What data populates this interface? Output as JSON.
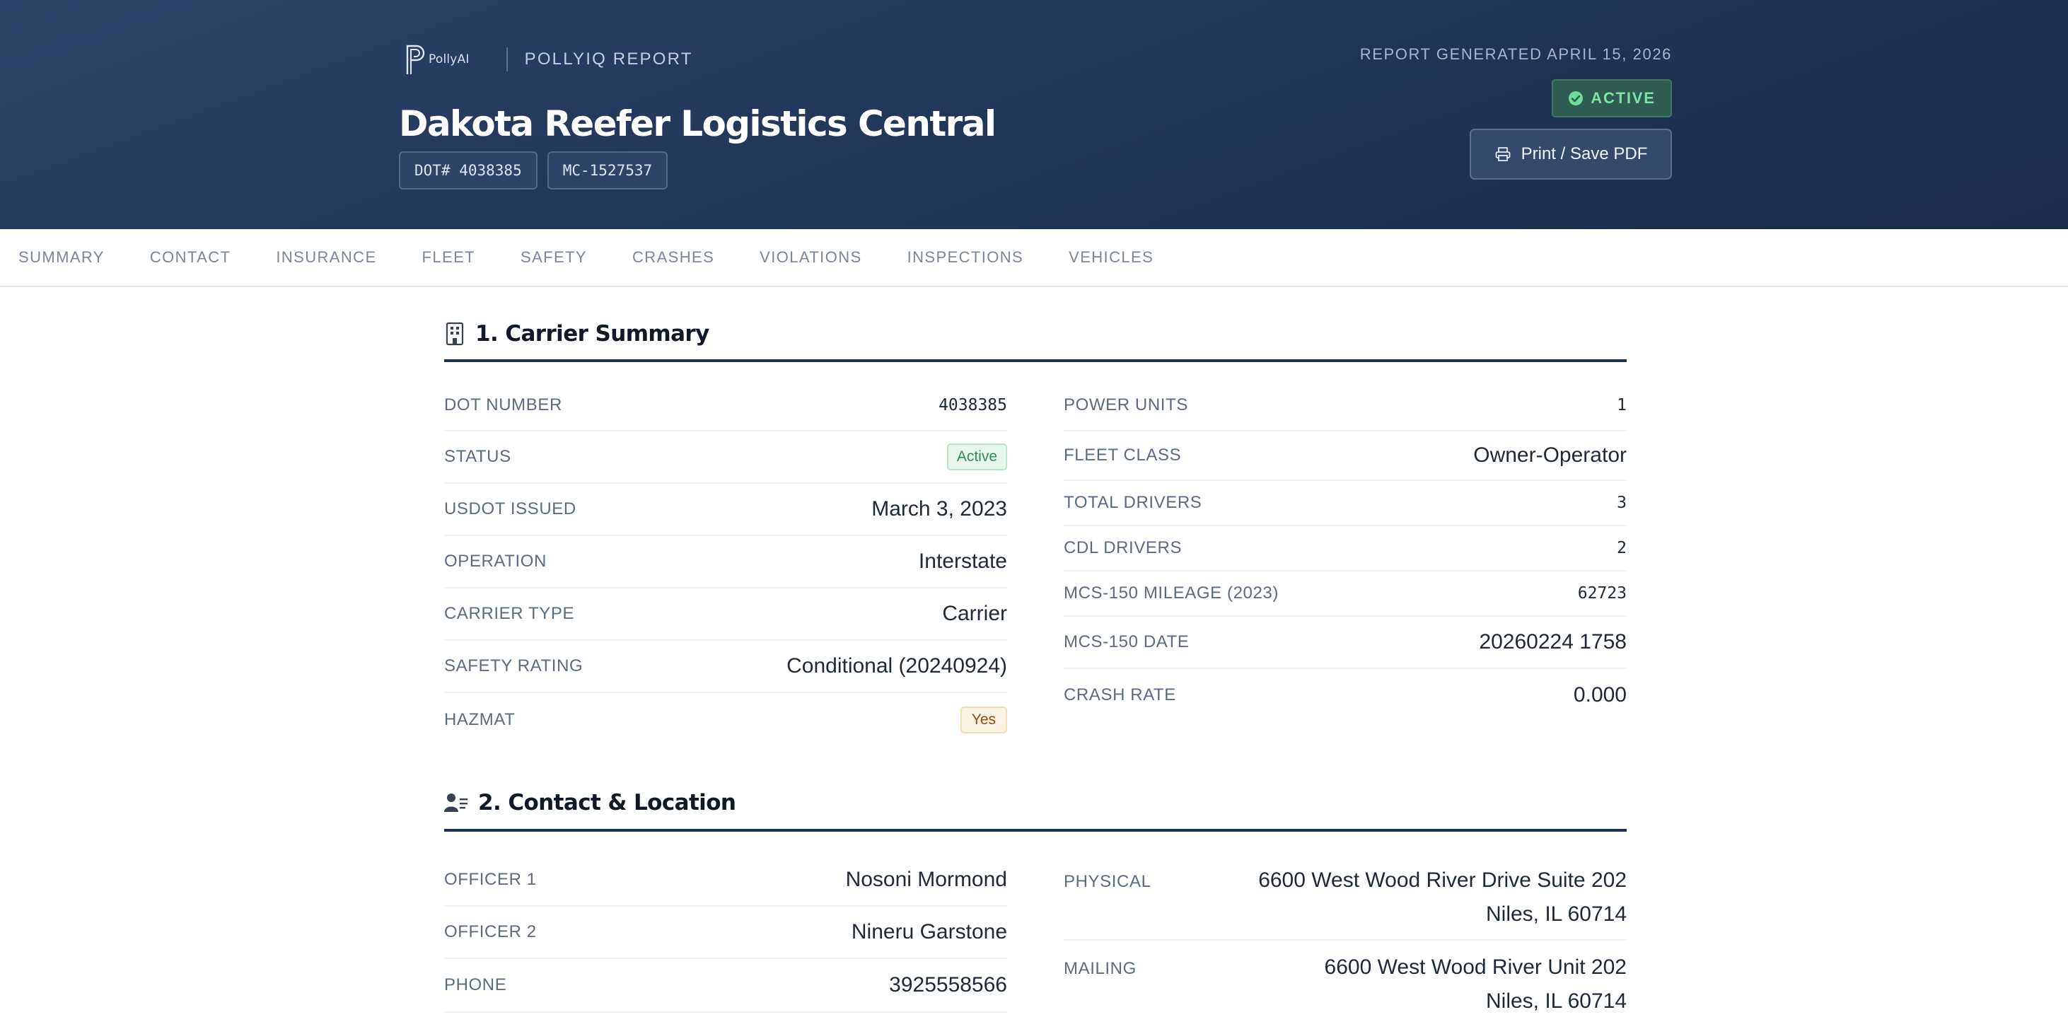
{
  "header": {
    "brand_logo_text": "PollyAI",
    "brand_report": "POLLYIQ REPORT",
    "company_name": "Dakota Reefer Logistics Central",
    "dot_chip": "DOT# 4038385",
    "mc_chip": "MC-1527537",
    "report_generated": "REPORT GENERATED APRIL 15, 2026",
    "status_badge": "ACTIVE",
    "print_label": "Print / Save PDF"
  },
  "nav": {
    "items": [
      "SUMMARY",
      "CONTACT",
      "INSURANCE",
      "FLEET",
      "SAFETY",
      "CRASHES",
      "VIOLATIONS",
      "INSPECTIONS",
      "VEHICLES"
    ]
  },
  "summary": {
    "title": "1. Carrier Summary",
    "left": [
      {
        "label": "DOT NUMBER",
        "value": "4038385"
      },
      {
        "label": "STATUS",
        "value": "Active"
      },
      {
        "label": "USDOT ISSUED",
        "value": "March 3, 2023"
      },
      {
        "label": "OPERATION",
        "value": "Interstate"
      },
      {
        "label": "CARRIER TYPE",
        "value": "Carrier"
      },
      {
        "label": "SAFETY RATING",
        "value": "Conditional (20240924)"
      },
      {
        "label": "HAZMAT",
        "value": "Yes"
      }
    ],
    "right": [
      {
        "label": "POWER UNITS",
        "value": "1"
      },
      {
        "label": "FLEET CLASS",
        "value": "Owner-Operator"
      },
      {
        "label": "TOTAL DRIVERS",
        "value": "3"
      },
      {
        "label": "CDL DRIVERS",
        "value": "2"
      },
      {
        "label": "MCS-150 MILEAGE (2023)",
        "value": "62723"
      },
      {
        "label": "MCS-150 DATE",
        "value": "20260224 1758"
      },
      {
        "label": "CRASH RATE",
        "value": "0.000"
      }
    ]
  },
  "contact": {
    "title": "2. Contact & Location",
    "left": [
      {
        "label": "OFFICER 1",
        "value": "Nosoni Mormond"
      },
      {
        "label": "OFFICER 2",
        "value": "Nineru Garstone"
      },
      {
        "label": "PHONE",
        "value": "3925558566"
      }
    ],
    "right": [
      {
        "label": "PHYSICAL",
        "line1": "6600 West Wood River Drive Suite 202",
        "line2": "Niles, IL 60714"
      },
      {
        "label": "MAILING",
        "line1": "6600 West Wood River Unit 202",
        "line2": "Niles, IL 60714"
      }
    ]
  }
}
